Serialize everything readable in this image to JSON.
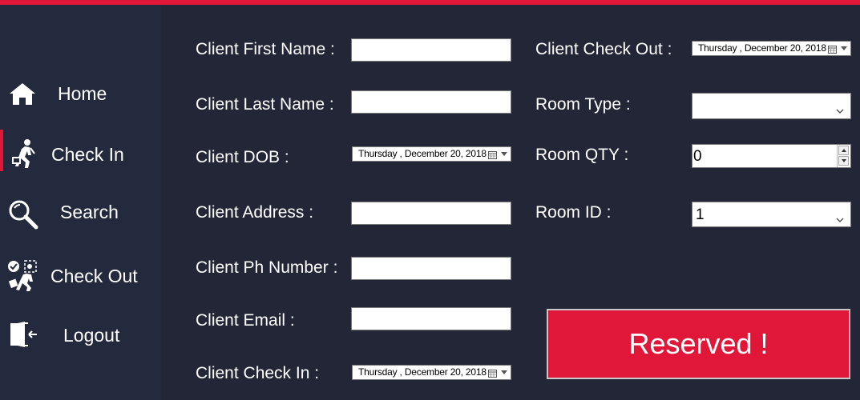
{
  "colors": {
    "accent": "#e01739",
    "sidebar_bg": "#242a3d",
    "main_bg": "#222636"
  },
  "sidebar": {
    "items": [
      {
        "label": "Home",
        "icon": "home-icon"
      },
      {
        "label": "Check In",
        "icon": "check-in-icon",
        "active": true
      },
      {
        "label": "Search",
        "icon": "search-icon"
      },
      {
        "label": "Check Out",
        "icon": "check-out-icon"
      },
      {
        "label": "Logout",
        "icon": "logout-icon"
      }
    ]
  },
  "form": {
    "first_name": {
      "label": "Client First Name :",
      "value": ""
    },
    "last_name": {
      "label": "Client Last Name :",
      "value": ""
    },
    "dob": {
      "label": "Client DOB :",
      "value": "Thursday   , December 20, 2018"
    },
    "address": {
      "label": "Client Address :",
      "value": ""
    },
    "phone": {
      "label": "Client Ph Number :",
      "value": ""
    },
    "email": {
      "label": "Client Email :",
      "value": ""
    },
    "check_in": {
      "label": "Client Check In :",
      "value": "Thursday   , December 20, 2018"
    },
    "check_out": {
      "label": "Client Check Out :",
      "value": "Thursday   , December 20, 2018"
    },
    "room_type": {
      "label": "Room Type :",
      "value": ""
    },
    "room_qty": {
      "label": "Room QTY :",
      "value": "0"
    },
    "room_id": {
      "label": "Room ID :",
      "value": "1"
    }
  },
  "reserve_button": {
    "label": "Reserved !"
  }
}
